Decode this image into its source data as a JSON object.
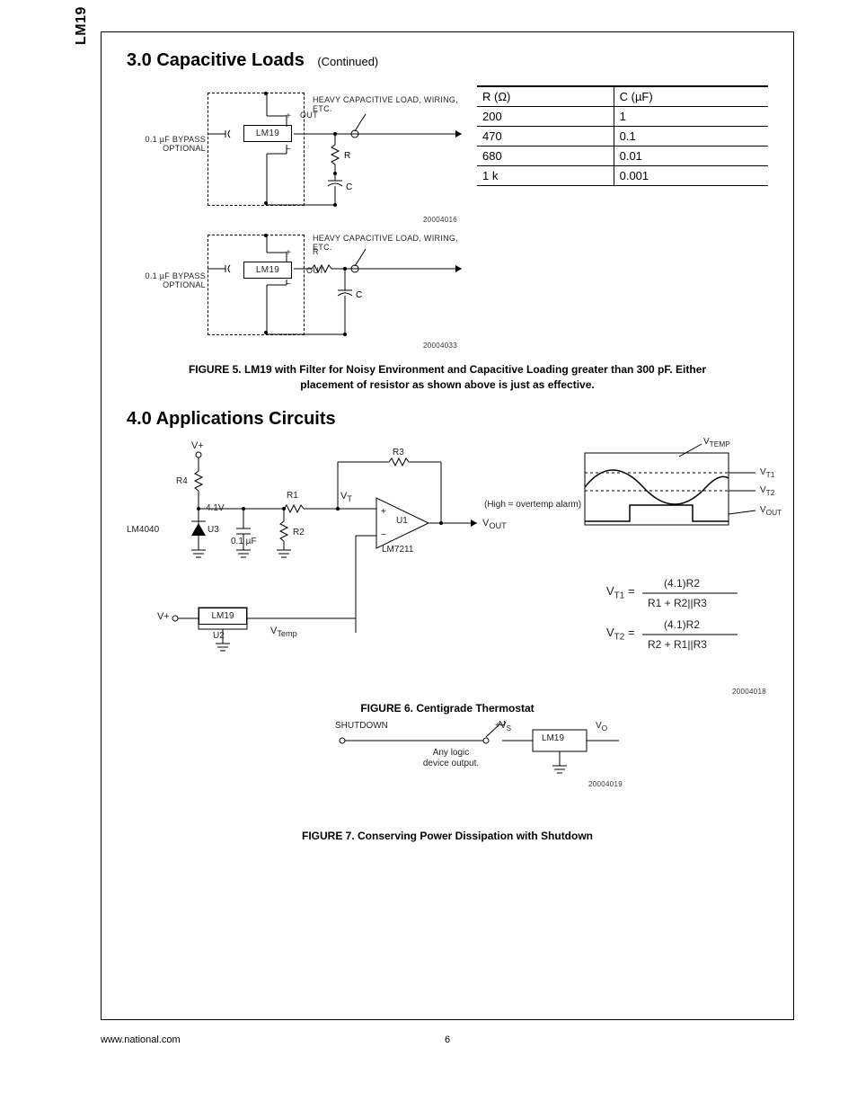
{
  "side_header": "LM19",
  "section3": {
    "heading": "3.0 Capacitive Loads",
    "continued": "(Continued)"
  },
  "schematic_a": {
    "load_text": "HEAVY CAPACITIVE LOAD, WIRING, ETC.",
    "out": "OUT",
    "chip": "LM19",
    "plus": "+",
    "minus": "−",
    "bypass_line1": "0.1 µF BYPASS",
    "bypass_line2": "OPTIONAL",
    "R": "R",
    "C": "C",
    "num": "20004016"
  },
  "schematic_b": {
    "load_text": "HEAVY CAPACITIVE LOAD, WIRING, ETC.",
    "out": "OUT",
    "chip": "LM19",
    "plus": "+",
    "minus": "−",
    "bypass_line1": "0.1 µF BYPASS",
    "bypass_line2": "OPTIONAL",
    "R": "R",
    "C": "C",
    "num": "20004033"
  },
  "rc_table": {
    "headers": {
      "r": "R (Ω)",
      "c": "C (µF)"
    },
    "rows": [
      {
        "r": "200",
        "c": "1"
      },
      {
        "r": "470",
        "c": "0.1"
      },
      {
        "r": "680",
        "c": "0.01"
      },
      {
        "r": "1 k",
        "c": "0.001"
      }
    ]
  },
  "figure5_caption": "FIGURE 5. LM19 with Filter for Noisy Environment and Capacitive Loading greater than 300 pF. Either placement of resistor as shown above is just as effective.",
  "section4_heading": "4.0 Applications Circuits",
  "fig6": {
    "Vplus": "V+",
    "R1": "R1",
    "R2": "R2",
    "R3": "R3",
    "R4": "R4",
    "Vt": "V",
    "Vt_sub": "T",
    "Vref": "4.1V",
    "U1": "U1",
    "U2": "U2",
    "U3": "U3",
    "LM4040": "LM4040",
    "LM19": "LM19",
    "LM7211": "LM7211",
    "cap": "0.1 µF",
    "Vtemp": "V",
    "Vtemp_sub": "Temp",
    "Vout": "V",
    "Vout_sub": "OUT",
    "alarm": "(High = overtemp alarm)",
    "wave_Vtemp": "V",
    "wave_Vtemp_sub": "TEMP",
    "wave_Vt1": "V",
    "wave_Vt1_sub": "T1",
    "wave_Vt2": "V",
    "wave_Vt2_sub": "T2",
    "wave_Vout": "V",
    "wave_Vout_sub": "OUT",
    "eq1_lhs_a": "V",
    "eq1_lhs_b": "T1",
    "eq1_num": "(4.1)R2",
    "eq1_den": "R1 + R2||R3",
    "eq2_lhs_a": "V",
    "eq2_lhs_b": "T2",
    "eq2_num": "(4.1)R2",
    "eq2_den": "R2 + R1||R3",
    "num": "20004018"
  },
  "figure6_caption": "FIGURE 6. Centigrade Thermostat",
  "fig7": {
    "shutdown": "SHUTDOWN",
    "anylogic_l1": "Any logic",
    "anylogic_l2": "device output.",
    "plusVs": "+V",
    "plusVs_sub": "S",
    "chip": "LM19",
    "Vo": "V",
    "Vo_sub": "O",
    "num": "20004019"
  },
  "figure7_caption": "FIGURE 7. Conserving Power Dissipation with Shutdown",
  "footer": {
    "url": "www.national.com",
    "page": "6"
  }
}
